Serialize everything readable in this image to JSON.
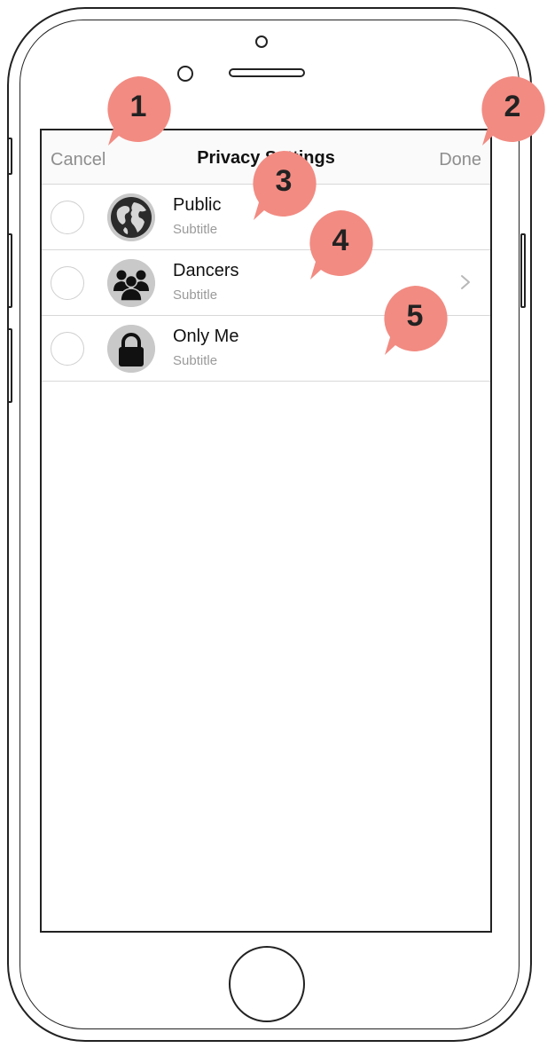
{
  "navbar": {
    "cancel_label": "Cancel",
    "title": "Privacy Settings",
    "done_label": "Done"
  },
  "options": [
    {
      "title": "Public",
      "subtitle": "Subtitle",
      "icon": "globe-icon",
      "has_chevron": false
    },
    {
      "title": "Dancers",
      "subtitle": "Subtitle",
      "icon": "group-icon",
      "has_chevron": true
    },
    {
      "title": "Only Me",
      "subtitle": "Subtitle",
      "icon": "lock-icon",
      "has_chevron": false
    }
  ],
  "callouts": [
    "1",
    "2",
    "3",
    "4",
    "5"
  ],
  "colors": {
    "callout": "#f28b82",
    "nav_text_muted": "#8e8e8e",
    "divider": "#d8d8d8"
  }
}
